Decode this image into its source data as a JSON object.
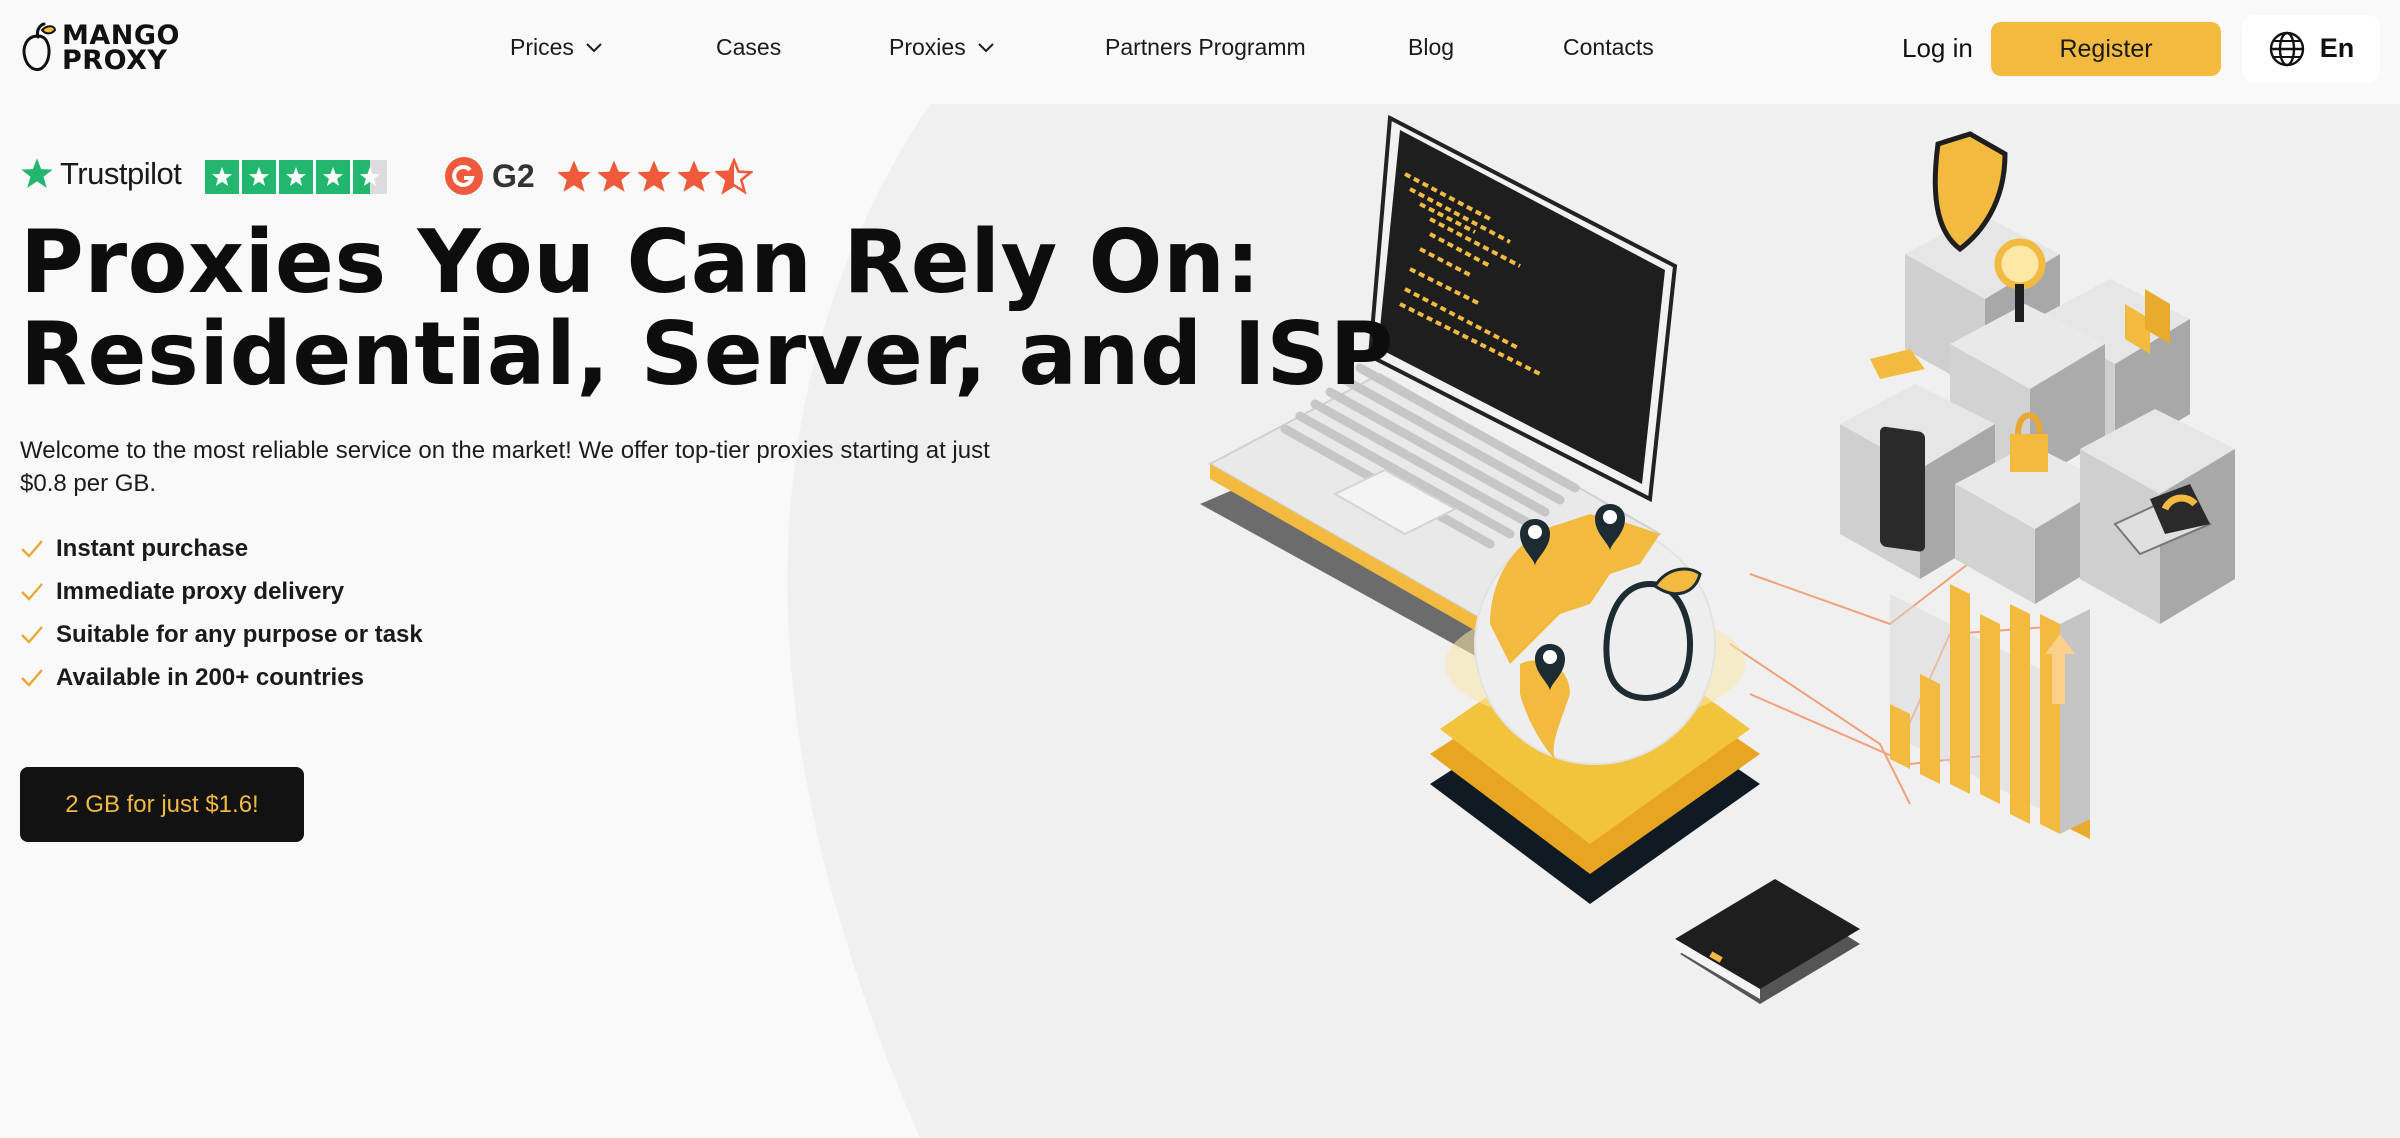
{
  "brand": {
    "line1": "MANGO",
    "line2": "PROXY",
    "logo_icon": "mango-icon"
  },
  "nav": {
    "items": [
      {
        "label": "Prices",
        "dropdown": true
      },
      {
        "label": "Cases",
        "dropdown": false
      },
      {
        "label": "Proxies",
        "dropdown": true
      },
      {
        "label": "Partners Programm",
        "dropdown": false
      },
      {
        "label": "Blog",
        "dropdown": false
      },
      {
        "label": "Contacts",
        "dropdown": false
      }
    ]
  },
  "header": {
    "login_label": "Log in",
    "register_label": "Register",
    "language_label": "En",
    "language_icon": "globe-icon"
  },
  "ratings": {
    "trustpilot": {
      "label": "Trustpilot",
      "stars": 4.5,
      "color": "#22b66f"
    },
    "g2": {
      "label": "G2",
      "stars": 4.5,
      "color": "#ef5a3c"
    }
  },
  "hero": {
    "title_line1": "Proxies You Can Rely On:",
    "title_line2": "Residential, Server, and ISP",
    "subtitle": "Welcome to the most reliable service on the market! We offer top-tier proxies starting at just $0.8 per GB.",
    "features": [
      "Instant purchase",
      "Immediate proxy delivery",
      "Suitable for any purpose or task",
      "Available in 200+ countries"
    ],
    "cta_label": "2 GB for just $1.6!"
  },
  "colors": {
    "accent": "#f2bb40",
    "dark": "#121212",
    "background": "#f9f9f9",
    "hero_panel": "#f0f0f0"
  }
}
